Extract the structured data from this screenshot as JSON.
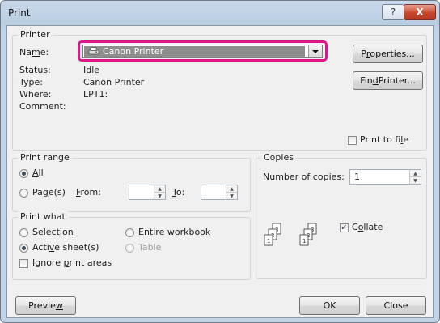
{
  "window": {
    "title": "Print",
    "help_glyph": "?",
    "close_glyph": "X"
  },
  "printer": {
    "legend": "Printer",
    "name_label": "Name:",
    "name_value": "Canon Printer",
    "status_label": "Status:",
    "status_value": "Idle",
    "type_label": "Type:",
    "type_value": "Canon Printer",
    "where_label": "Where:",
    "where_value": "LPT1:",
    "comment_label": "Comment:",
    "properties_button": "Properties...",
    "find_printer_button": "Find Printer...",
    "print_to_file_label": "Print to file",
    "print_to_file_checked": false,
    "highlight_color": "#e0158c"
  },
  "print_range": {
    "legend": "Print range",
    "all_label": "All",
    "all_selected": true,
    "pages_label": "Page(s)",
    "from_label": "From:",
    "from_value": "",
    "to_label": "To:",
    "to_value": ""
  },
  "copies": {
    "legend": "Copies",
    "number_label": "Number of copies:",
    "number_value": "1",
    "collate_label": "Collate",
    "collate_checked": true
  },
  "print_what": {
    "legend": "Print what",
    "selection_label": "Selection",
    "entire_workbook_label": "Entire workbook",
    "active_sheets_label": "Active sheet(s)",
    "active_sheets_selected": true,
    "table_label": "Table",
    "ignore_print_areas_label": "Ignore print areas"
  },
  "footer": {
    "preview_button": "Preview",
    "ok_button": "OK",
    "close_button": "Close"
  }
}
